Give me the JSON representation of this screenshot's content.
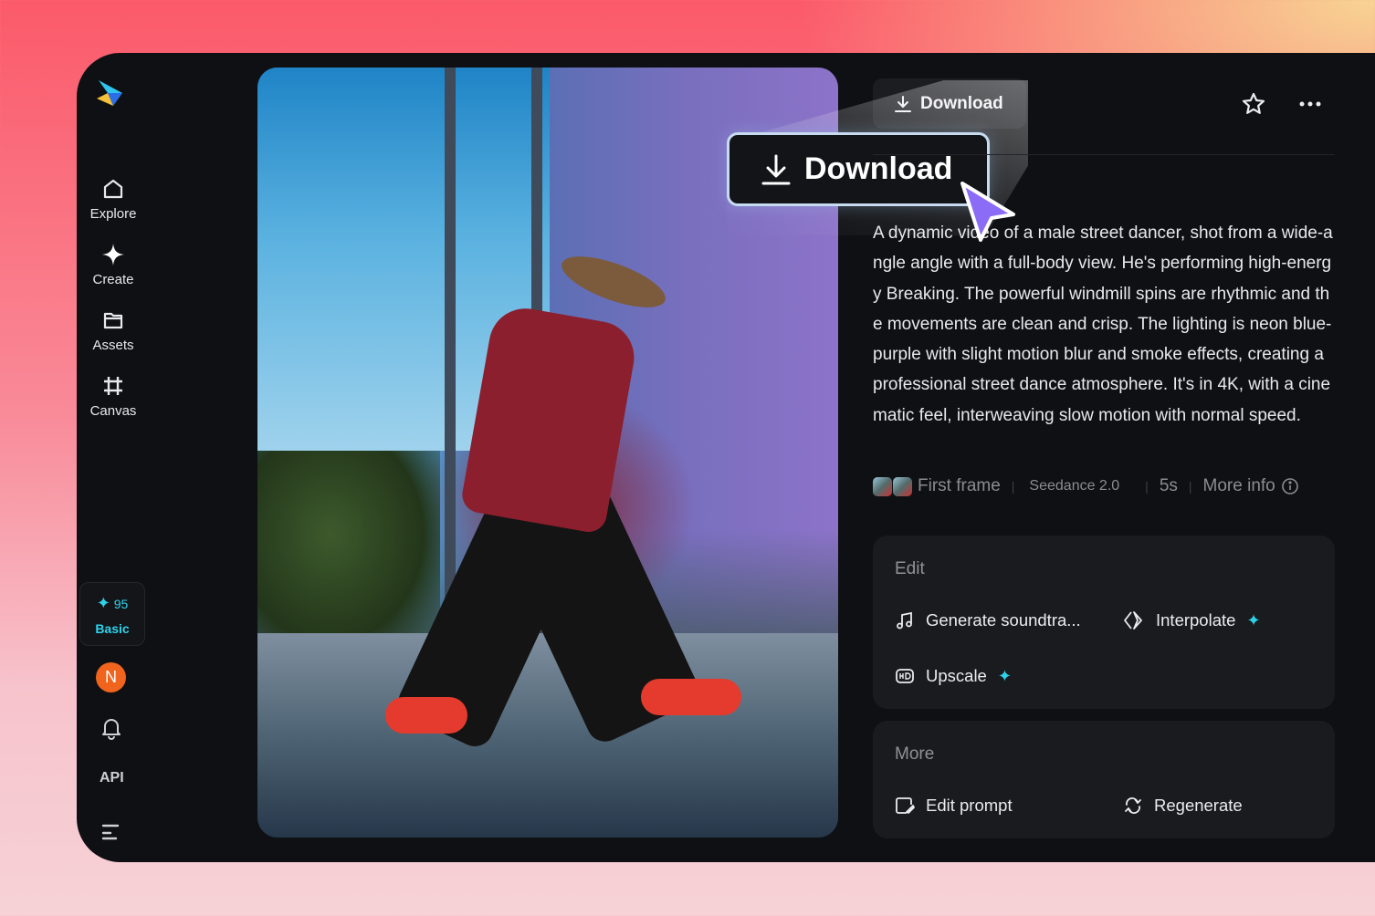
{
  "sidebar": {
    "items": [
      {
        "label": "Explore",
        "icon": "home-icon"
      },
      {
        "label": "Create",
        "icon": "sparkle-icon"
      },
      {
        "label": "Assets",
        "icon": "folder-icon"
      },
      {
        "label": "Canvas",
        "icon": "canvas-frame-icon"
      }
    ],
    "credits": {
      "count": "95",
      "plan": "Basic"
    },
    "avatar_initial": "N",
    "api_label": "API"
  },
  "toolbar": {
    "download_label": "Download"
  },
  "highlight": {
    "download_label": "Download"
  },
  "prompt": "A dynamic video of a male street dancer, shot from a wide-angle angle with a full-body view. He's performing high-energy Breaking. The powerful windmill spins are rhythmic and the movements are clean and crisp. The lighting is neon blue-purple with slight motion blur and smoke effects, creating a professional street dance atmosphere. It's in 4K, with a cinematic feel, interweaving slow motion with normal speed.",
  "meta": {
    "first_frame": "First frame",
    "model": "Seedance 2.0",
    "duration": "5s",
    "more_info": "More info"
  },
  "edit_card": {
    "title": "Edit",
    "actions": [
      {
        "label": "Generate soundtra...",
        "icon": "music-note-icon"
      },
      {
        "label": "Interpolate",
        "icon": "interpolate-icon",
        "premium": true
      },
      {
        "label": "Upscale",
        "icon": "hd-icon",
        "premium": true
      }
    ]
  },
  "more_card": {
    "title": "More",
    "actions": [
      {
        "label": "Edit prompt",
        "icon": "edit-prompt-icon"
      },
      {
        "label": "Regenerate",
        "icon": "regenerate-icon"
      }
    ]
  },
  "colors": {
    "accent": "#2ed3ea",
    "cursor": "#8b6cf6",
    "avatar": "#f0641d"
  }
}
